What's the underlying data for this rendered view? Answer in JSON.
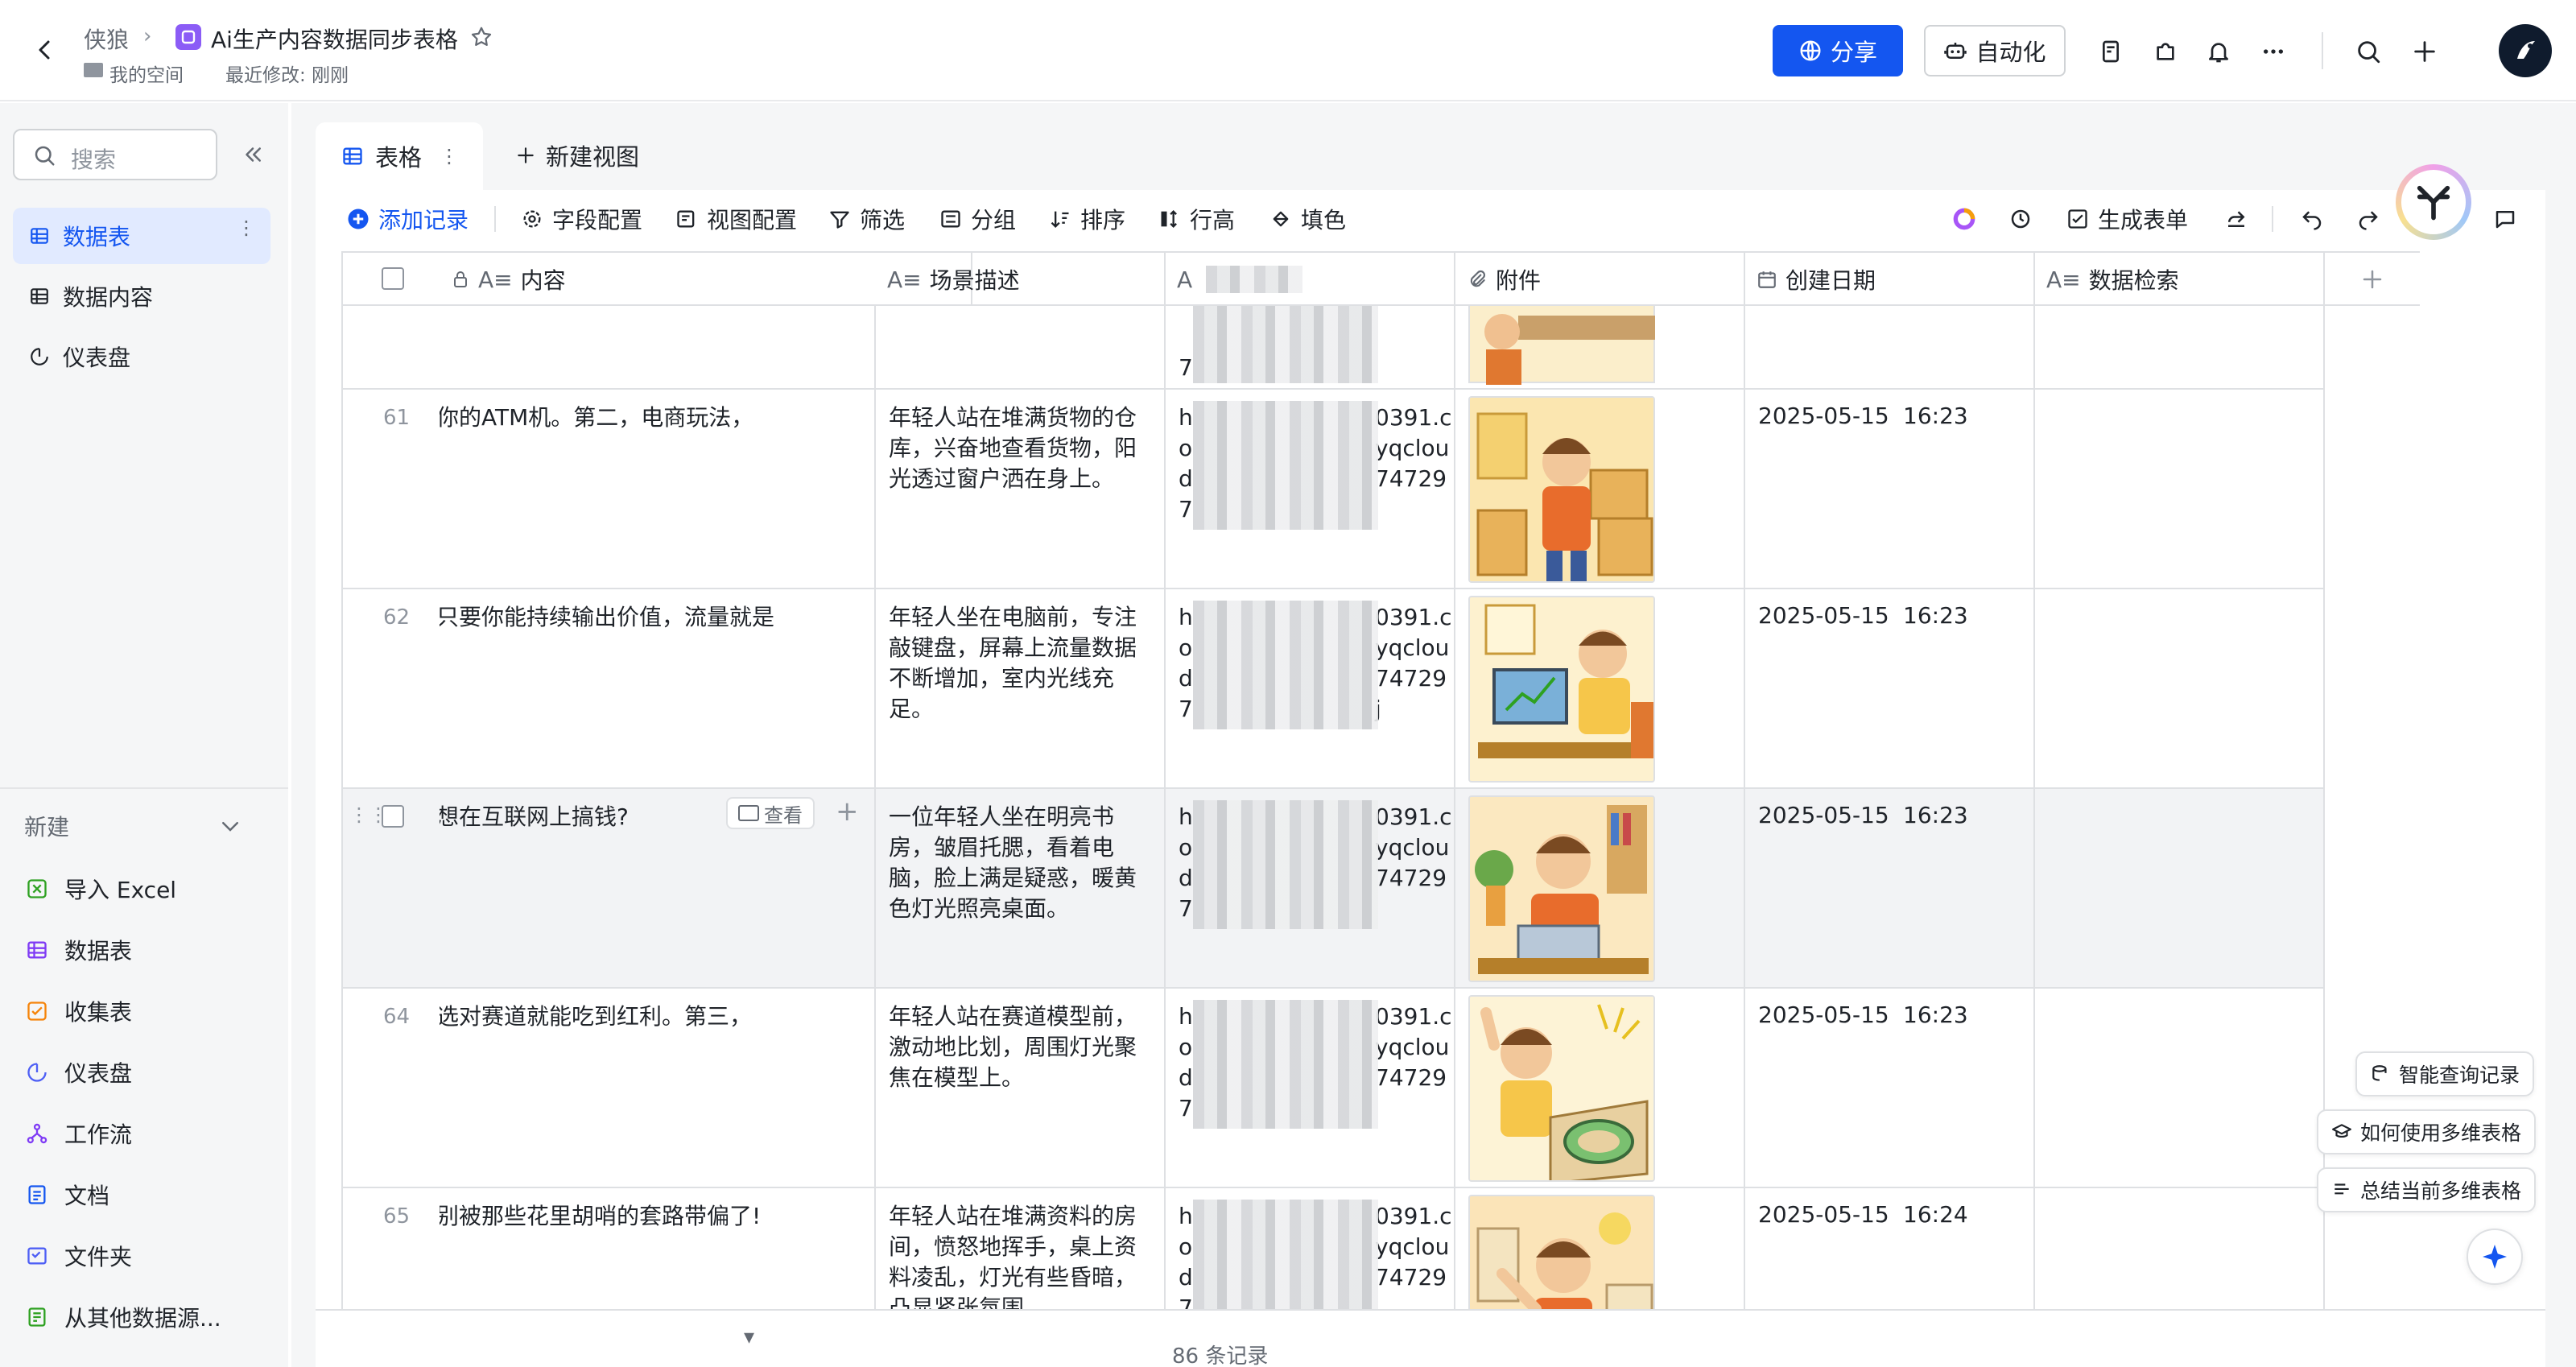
{
  "header": {
    "breadcrumb_root": "侠狼",
    "doc_title": "Ai生产内容数据同步表格",
    "location": "我的空间",
    "last_modified": "最近修改: 刚刚",
    "share_label": "分享",
    "automation_label": "自动化"
  },
  "sidebar": {
    "search_placeholder": "搜索",
    "items": [
      {
        "label": "数据表"
      },
      {
        "label": "数据内容"
      },
      {
        "label": "仪表盘"
      }
    ],
    "new_section": {
      "title": "新建",
      "items": [
        {
          "label": "导入 Excel"
        },
        {
          "label": "数据表"
        },
        {
          "label": "收集表"
        },
        {
          "label": "仪表盘"
        },
        {
          "label": "工作流"
        },
        {
          "label": "文档"
        },
        {
          "label": "文件夹"
        },
        {
          "label": "从其他数据源..."
        }
      ]
    }
  },
  "views": {
    "active_tab": "表格",
    "new_view": "新建视图"
  },
  "toolbar": {
    "add_record": "添加记录",
    "field_config": "字段配置",
    "view_config": "视图配置",
    "filter": "筛选",
    "group": "分组",
    "sort": "排序",
    "row_height": "行高",
    "fill_color": "填色",
    "generate_form": "生成表单"
  },
  "table": {
    "columns": [
      {
        "label": "内容"
      },
      {
        "label": "场景描述"
      },
      {
        "label": "附件"
      },
      {
        "label": "创建日期"
      },
      {
        "label": "数据检索"
      }
    ],
    "rows": [
      {
        "num": "61",
        "content": "你的ATM机。第二，电商玩法，",
        "scene": "年轻人站在堆满货物的仓库，兴奋地查看货物，阳光透过窗户洒在身上。",
        "link_lines": [
          "h",
          "o",
          "d",
          "7"
        ],
        "link_tails": [
          "0391.c",
          "yqclou",
          "74729",
          ""
        ],
        "date": "2025-05-15",
        "time": "16:23"
      },
      {
        "num": "62",
        "content": "只要你能持续输出价值，流量就是",
        "scene": "年轻人坐在电脑前，专注敲键盘，屏幕上流量数据不断增加，室内光线充足。",
        "link_lines": [
          "h",
          "o",
          "d",
          "7"
        ],
        "link_tails": [
          "0391.c",
          "yqclou",
          "74729",
          "j"
        ],
        "date": "2025-05-15",
        "time": "16:23"
      },
      {
        "num": "",
        "content": "想在互联网上搞钱?",
        "scene": "一位年轻人坐在明亮书房，皱眉托腮，看着电脑，脸上满是疑惑，暖黄色灯光照亮桌面。",
        "link_lines": [
          "h",
          "o",
          "d",
          "7"
        ],
        "link_tails": [
          "0391.c",
          "yqclou",
          "74729",
          ""
        ],
        "date": "2025-05-15",
        "time": "16:23"
      },
      {
        "num": "64",
        "content": "选对赛道就能吃到红利。第三，",
        "scene": "年轻人站在赛道模型前，激动地比划，周围灯光聚焦在模型上。",
        "link_lines": [
          "h",
          "o",
          "d",
          "7"
        ],
        "link_tails": [
          "0391.c",
          "yqclou",
          "74729",
          ""
        ],
        "date": "2025-05-15",
        "time": "16:23"
      },
      {
        "num": "65",
        "content": "别被那些花里胡哨的套路带偏了!",
        "scene": "年轻人站在堆满资料的房间，愤怒地挥手，桌上资料凌乱，灯光有些昏暗，凸显紧张氛围。",
        "link_lines": [
          "h",
          "o",
          "d",
          "7"
        ],
        "link_tails": [
          "0391.c",
          "yqclou",
          "74729",
          ""
        ],
        "date": "2025-05-15",
        "time": "16:24"
      }
    ],
    "hover_view_label": "查看",
    "record_count": "86 条记录"
  },
  "ai_panel": {
    "smart_query": "智能查询记录",
    "how_to_use": "如何使用多维表格",
    "summarize": "总结当前多维表格"
  },
  "colors": {
    "accent": "#1456f0",
    "sidebar_bg": "#f5f6f7",
    "active_bg": "#e1eaff"
  }
}
